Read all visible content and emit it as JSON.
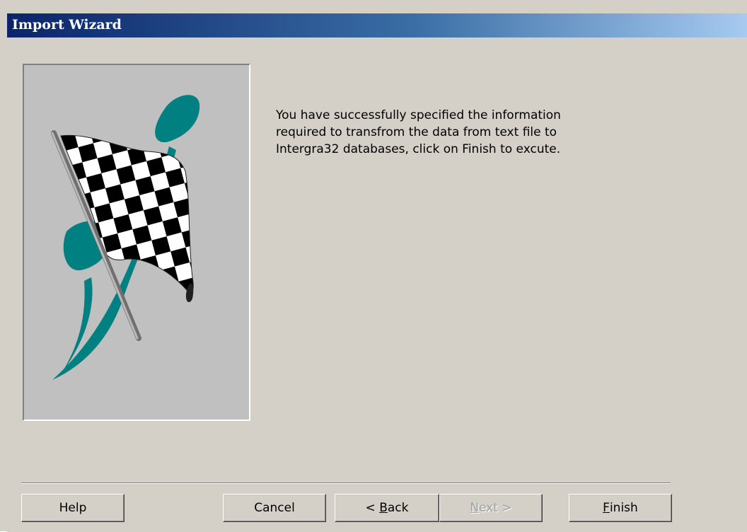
{
  "window": {
    "title": "Import Wizard"
  },
  "illustration": {
    "icon": "checkered-flag-icon",
    "colors": {
      "background": "#c0c0c0",
      "swoosh": "#008080",
      "pole": "#909090"
    }
  },
  "message": "You have successfully specified the information\nrequired to transfrom the data from text file to\nIntergra32 databases, click on Finish to excute.",
  "buttons": {
    "help": {
      "label": "Help",
      "enabled": true
    },
    "cancel": {
      "label": "Cancel",
      "enabled": true
    },
    "back": {
      "prefix": "< ",
      "mnemonic": "B",
      "rest": "ack",
      "enabled": true
    },
    "next": {
      "mnemonic": "N",
      "rest": "ext >",
      "enabled": false
    },
    "finish": {
      "mnemonic": "F",
      "rest": "inish",
      "enabled": true
    }
  },
  "colors": {
    "face": "#d4d0c8",
    "title_start": "#0a246a",
    "title_end": "#a6caf0",
    "title_text": "#ffffff"
  }
}
